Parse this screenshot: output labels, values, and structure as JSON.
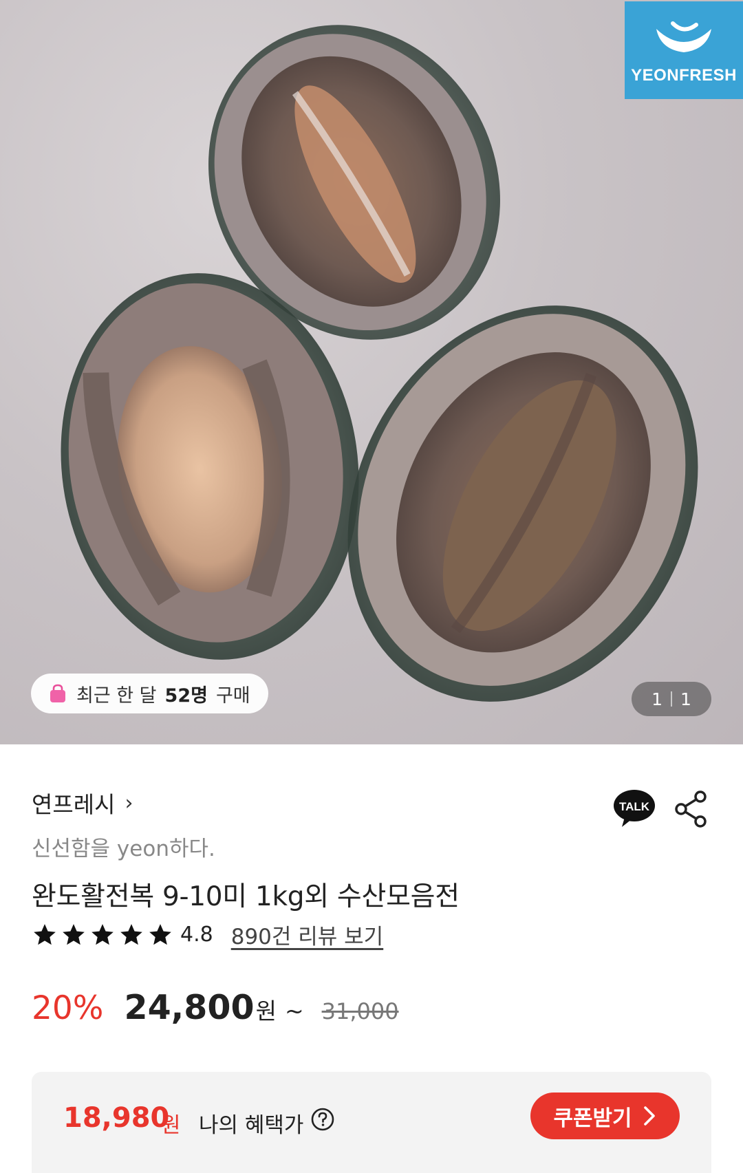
{
  "hero": {
    "brand_name": "YEONFRESH",
    "recent_buyers": {
      "prefix": "최근 한 달",
      "count": "52명",
      "suffix": "구매"
    },
    "counter": {
      "current": "1",
      "total": "1"
    }
  },
  "product": {
    "seller": "연프레시",
    "seller_chevron": "›",
    "tagline": "신선함을 yeon하다.",
    "title": "완도활전복 9-10미 1kg외 수산모음전",
    "rating": 4.8,
    "rating_text": "4.8",
    "stars_filled": 5,
    "review_link": "890건 리뷰 보기"
  },
  "price": {
    "discount": "20%",
    "sale_price": "24,800",
    "currency": "원",
    "tilde": "~",
    "original_price": "31,000"
  },
  "benefit": {
    "price": "18,980",
    "currency": "원",
    "label": "나의 혜택가",
    "coupon_button": "쿠폰받기"
  },
  "icons": {
    "talk": "kakao-talk-icon",
    "share": "share-icon",
    "help": "question-circle-icon",
    "bag": "shopping-bag-icon",
    "star": "star-icon"
  },
  "colors": {
    "accent_red": "#e8352c",
    "brand_blue": "#3aa3d6",
    "benefit_bg": "#f3f3f3"
  }
}
